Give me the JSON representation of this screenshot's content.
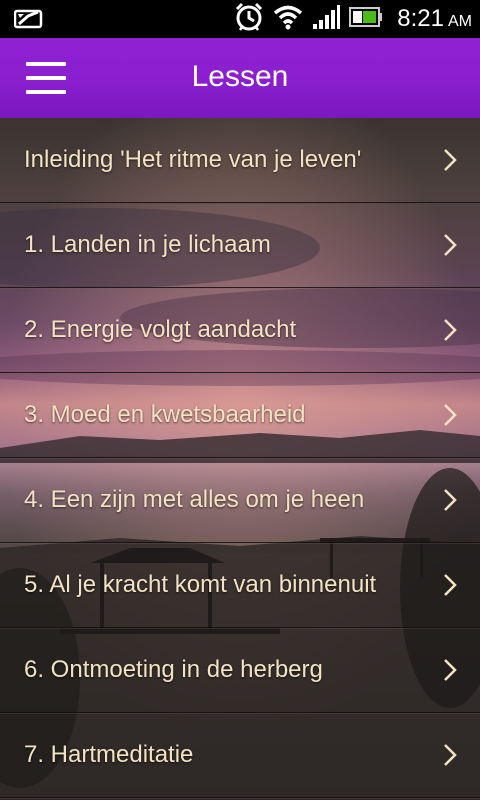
{
  "status_bar": {
    "time": "8:21",
    "ampm": "AM",
    "icons": [
      "notification-icon",
      "alarm-icon",
      "wifi-icon",
      "signal-icon",
      "battery-icon"
    ]
  },
  "app_bar": {
    "title": "Lessen",
    "menu_icon": "hamburger-menu-icon"
  },
  "lessons": [
    {
      "label": "Inleiding 'Het ritme van je leven'"
    },
    {
      "label": "1. Landen in je lichaam"
    },
    {
      "label": "2. Energie volgt aandacht"
    },
    {
      "label": "3. Moed en kwetsbaarheid"
    },
    {
      "label": "4. Een zijn met alles om je heen"
    },
    {
      "label": "5. Al je kracht komt van binnenuit"
    },
    {
      "label": "6. Ontmoeting in de herberg"
    },
    {
      "label": "7. Hartmeditatie"
    }
  ],
  "colors": {
    "app_bar": "#8b1fcf",
    "item_text": "#f3e3c2",
    "chevron": "#f3e3c2"
  }
}
